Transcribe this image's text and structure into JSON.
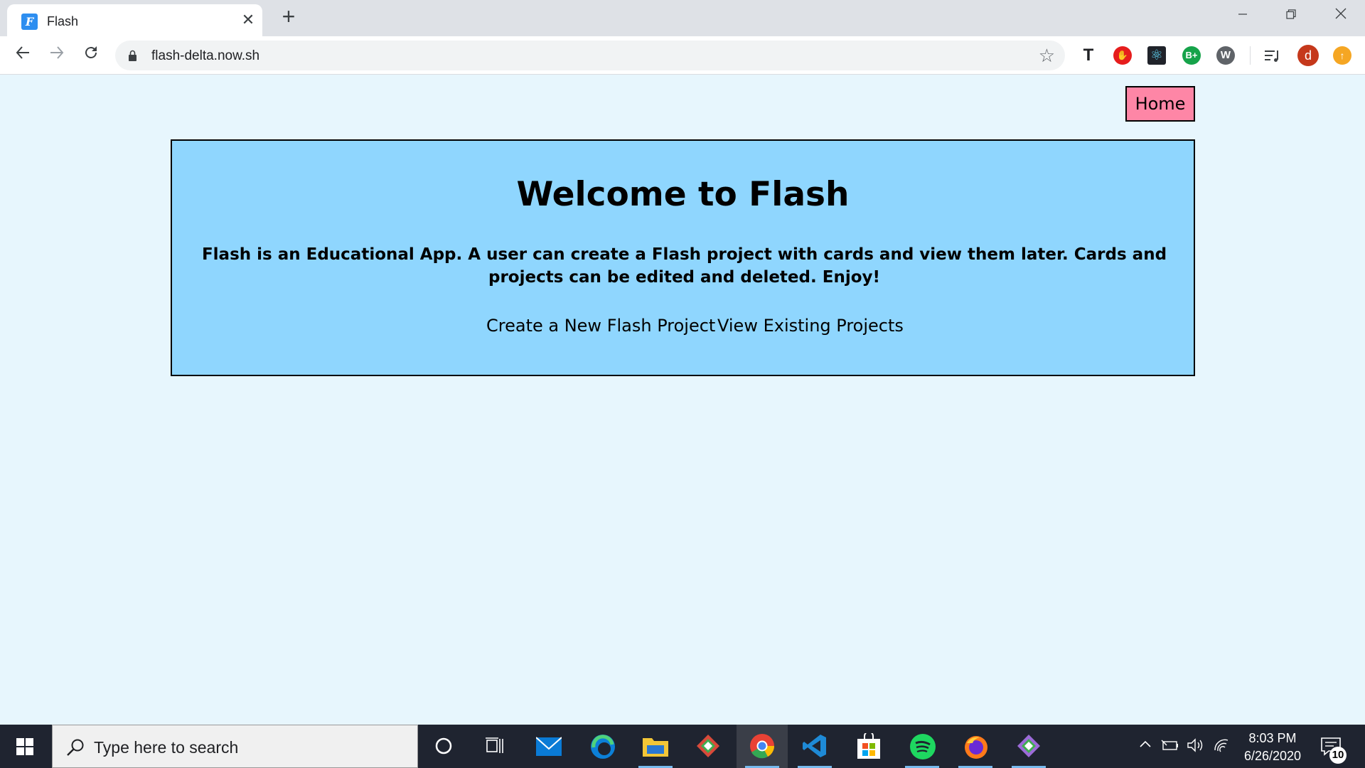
{
  "browser": {
    "tab": {
      "title": "Flash",
      "favicon": "F"
    },
    "url": "flash-delta.now.sh",
    "extensions": [
      "text-icon",
      "adblock-icon",
      "react-devtools-icon",
      "grammar-icon",
      "wappalyzer-icon",
      "media-icon",
      "profile-avatar",
      "update-icon"
    ],
    "profile_letter": "d",
    "extension_labels": {
      "grammar": "B+"
    }
  },
  "page": {
    "nav": {
      "home_label": "Home"
    },
    "card": {
      "title": "Welcome to Flash",
      "description": "Flash is an Educational App. A user can create a Flash project with cards and view them later. Cards and projects can be edited and deleted. Enjoy!",
      "links": {
        "create": "Create a New Flash Project",
        "view": "View Existing Projects"
      }
    },
    "colors": {
      "background": "#e7f6fd",
      "card": "#8fd6fe",
      "home_button": "#fe86a6"
    }
  },
  "taskbar": {
    "search_placeholder": "Type here to search",
    "time": "8:03 PM",
    "date": "6/26/2020",
    "notification_count": "10"
  }
}
